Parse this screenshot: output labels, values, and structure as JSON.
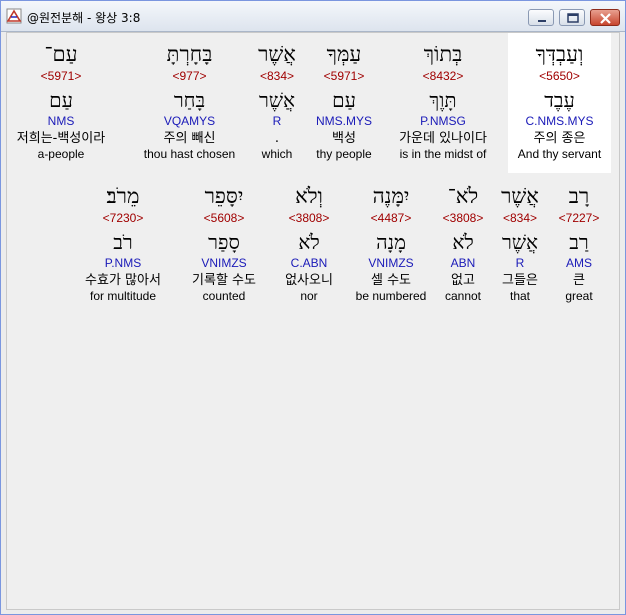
{
  "window": {
    "title": "@원전분해 - 왕상 3:8",
    "minimize_label": "minimize",
    "maximize_label": "maximize",
    "close_label": "close"
  },
  "rows": [
    {
      "words": [
        {
          "hebrew": "עַם־",
          "strong": "<5971>",
          "lemma": "עַם",
          "parse": "NMS",
          "korean": "저희는-백성이라",
          "english": "a-people",
          "selected": false
        },
        {
          "hebrew": "בָּחָרְתָּ",
          "strong": "<977>",
          "lemma": "בָּחַר",
          "parse": "VQAMYS",
          "korean": "주의 빼신",
          "english": "thou hast chosen",
          "selected": false
        },
        {
          "hebrew": "אֲשֶׁר",
          "strong": "<834>",
          "lemma": "אֲשֶׁר",
          "parse": "R",
          "korean": ".",
          "english": "which",
          "selected": false
        },
        {
          "hebrew": "עַמְּךָ",
          "strong": "<5971>",
          "lemma": "עַם",
          "parse": "NMS.MYS",
          "korean": "백성",
          "english": "thy people",
          "selected": false
        },
        {
          "hebrew": "בְּתוֹךְ",
          "strong": "<8432>",
          "lemma": "תָּוֶךְ",
          "parse": "P.NMSG",
          "korean": "가운데 있나이다",
          "english": "is in the midst of",
          "selected": false
        },
        {
          "hebrew": "וְעַבְדְּךָ",
          "strong": "<5650>",
          "lemma": "עֶבֶד",
          "parse": "C.NMS.MYS",
          "korean": "주의 종은",
          "english": "And thy servant",
          "selected": true
        }
      ]
    },
    {
      "words": [
        {
          "hebrew": "מֵרֹב׃",
          "strong": "<7230>",
          "lemma": "רֹב",
          "parse": "P.NMS",
          "korean": "수효가 많아서",
          "english": "for multitude",
          "selected": false
        },
        {
          "hebrew": "יִסָּפֵר",
          "strong": "<5608>",
          "lemma": "סָפַר",
          "parse": "VNIMZS",
          "korean": "기록할 수도",
          "english": "counted",
          "selected": false
        },
        {
          "hebrew": "וְלֹא",
          "strong": "<3808>",
          "lemma": "לֹא",
          "parse": "C.ABN",
          "korean": "없사오니",
          "english": "nor",
          "selected": false
        },
        {
          "hebrew": "יִמָּנֶה",
          "strong": "<4487>",
          "lemma": "מָנָה",
          "parse": "VNIMZS",
          "korean": "셀 수도",
          "english": "be numbered",
          "selected": false
        },
        {
          "hebrew": "לֹא־",
          "strong": "<3808>",
          "lemma": "לֹא",
          "parse": "ABN",
          "korean": "없고",
          "english": "cannot",
          "selected": false
        },
        {
          "hebrew": "אֲשֶׁר",
          "strong": "<834>",
          "lemma": "אֲשֶׁר",
          "parse": "R",
          "korean": "그들은",
          "english": "that",
          "selected": false
        },
        {
          "hebrew": "רָב",
          "strong": "<7227>",
          "lemma": "רַב",
          "parse": "AMS",
          "korean": "큰",
          "english": "great",
          "selected": false
        }
      ]
    }
  ]
}
